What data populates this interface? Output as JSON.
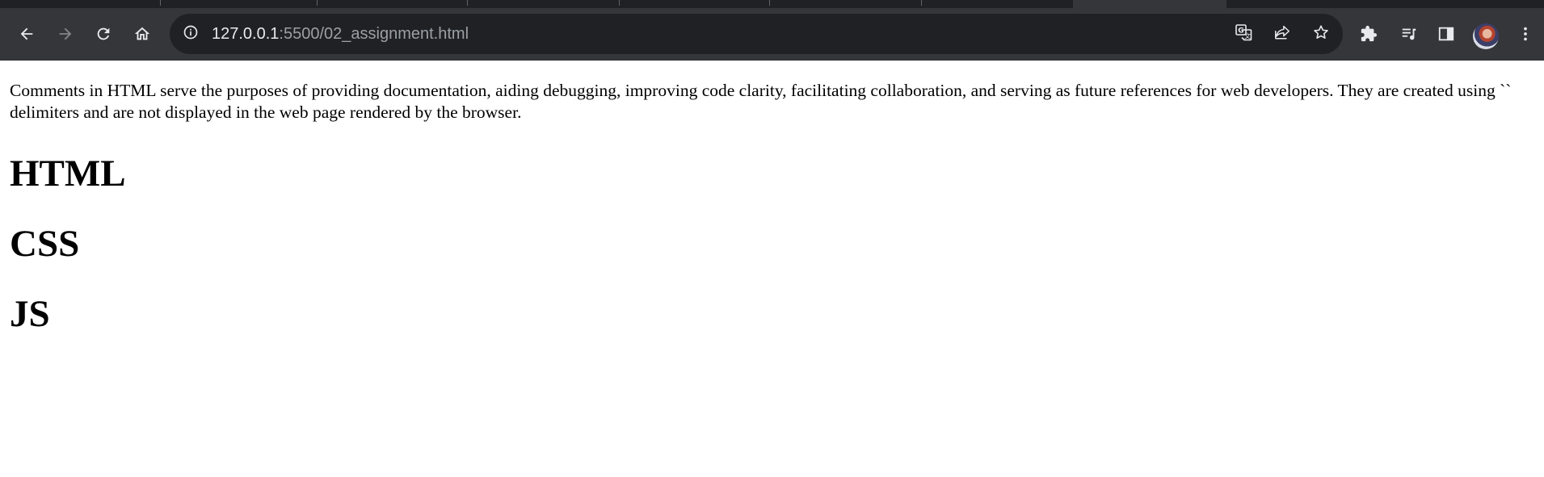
{
  "browser": {
    "url_host": "127.0.0.1",
    "url_path": ":5500/02_assignment.html",
    "icons": {
      "back": "arrow-left-icon",
      "forward": "arrow-right-icon",
      "reload": "reload-icon",
      "home": "home-icon",
      "site_info": "info-icon",
      "translate": "translate-icon",
      "share": "share-icon",
      "bookmark": "star-icon",
      "extensions": "puzzle-icon",
      "media": "playlist-icon",
      "side_panel": "side-panel-icon",
      "profile": "avatar",
      "menu": "kebab-menu-icon"
    },
    "colors": {
      "toolbar": "#35363a",
      "omnibox": "#202124",
      "tabstrip": "#202124",
      "icon": "#e8eaed",
      "icon_disabled": "#80868b"
    }
  },
  "page": {
    "paragraph": "Comments in HTML serve the purposes of providing documentation, aiding debugging, improving code clarity, facilitating collaboration, and serving as future references for web developers. They are created using `` delimiters and are not displayed in the web page rendered by the browser.",
    "headings": [
      "HTML",
      "CSS",
      "JS"
    ]
  }
}
